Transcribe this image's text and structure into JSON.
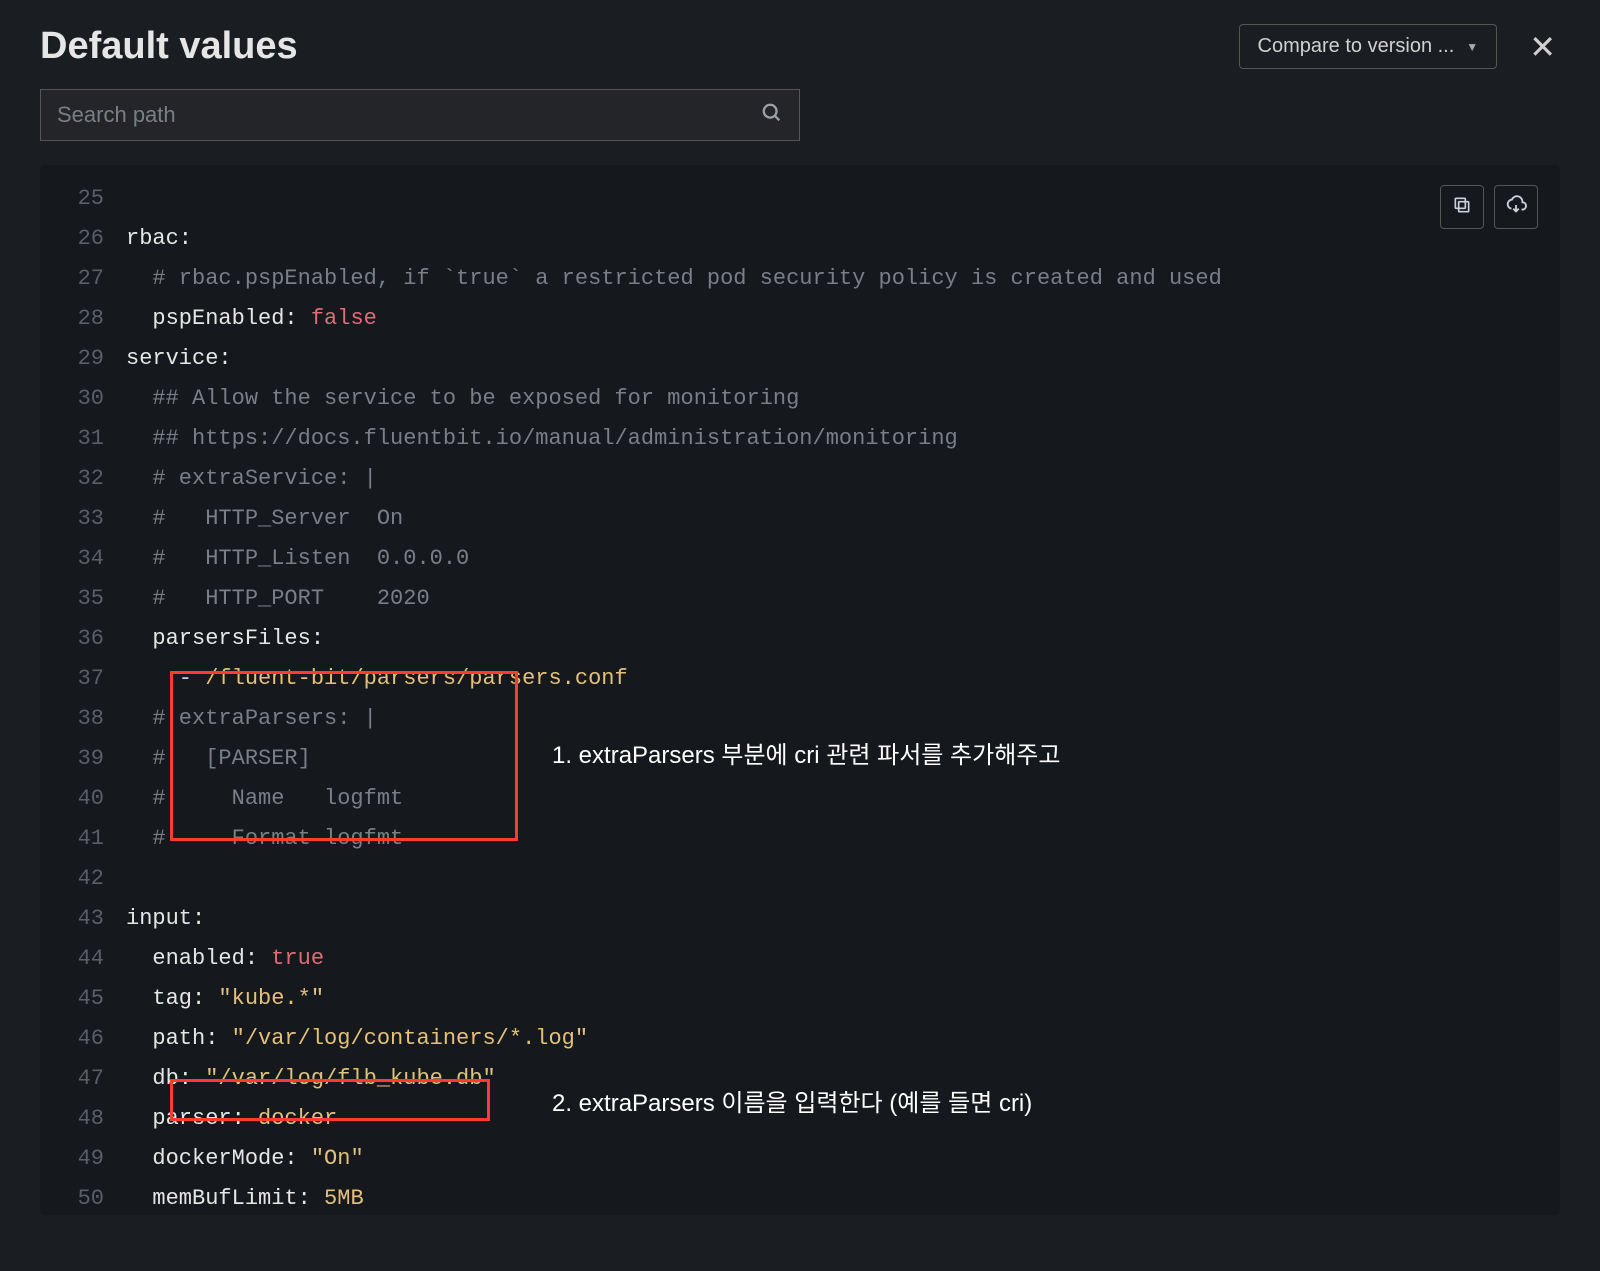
{
  "header": {
    "title": "Default values",
    "compare_label": "Compare to version ..."
  },
  "search": {
    "placeholder": "Search path"
  },
  "annotations": {
    "a1": "1. extraParsers 부분에 cri 관련 파서를 추가해주고",
    "a2": "2. extraParsers 이름을 입력한다 (예를 들면 cri)"
  },
  "lines": {
    "l25": "",
    "l26_key": "rbac:",
    "l27_c": "  # rbac.pspEnabled, if `true` a restricted pod security policy is created and used",
    "l28_key": "  pspEnabled: ",
    "l28_val": "false",
    "l29_key": "service:",
    "l30_c": "  ## Allow the service to be exposed for monitoring",
    "l31_c": "  ## https://docs.fluentbit.io/manual/administration/monitoring",
    "l32_c": "  # extraService: |",
    "l33_c": "  #   HTTP_Server  On",
    "l34_c": "  #   HTTP_Listen  0.0.0.0",
    "l35_c": "  #   HTTP_PORT    2020",
    "l36_key": "  parsersFiles:",
    "l37_dash": "    - ",
    "l37_val": "/fluent-bit/parsers/parsers.conf",
    "l38_c": "  # extraParsers: |",
    "l39_c": "  #   [PARSER]",
    "l40_c": "  #     Name   logfmt",
    "l41_c": "  #     Format logfmt",
    "l42": "",
    "l43_key": "input:",
    "l44_key": "  enabled: ",
    "l44_val": "true",
    "l45_key": "  tag: ",
    "l45_val": "\"kube.*\"",
    "l46_key": "  path: ",
    "l46_val": "\"/var/log/containers/*.log\"",
    "l47_key": "  db: ",
    "l47_val": "\"/var/log/flb_kube.db\"",
    "l48_key": "  parser: ",
    "l48_val": "docker",
    "l49_key": "  dockerMode: ",
    "l49_val": "\"On\"",
    "l50_key": "  memBufLimit: ",
    "l50_val": "5MB"
  },
  "line_numbers": {
    "n25": "25",
    "n26": "26",
    "n27": "27",
    "n28": "28",
    "n29": "29",
    "n30": "30",
    "n31": "31",
    "n32": "32",
    "n33": "33",
    "n34": "34",
    "n35": "35",
    "n36": "36",
    "n37": "37",
    "n38": "38",
    "n39": "39",
    "n40": "40",
    "n41": "41",
    "n42": "42",
    "n43": "43",
    "n44": "44",
    "n45": "45",
    "n46": "46",
    "n47": "47",
    "n48": "48",
    "n49": "49",
    "n50": "50"
  }
}
